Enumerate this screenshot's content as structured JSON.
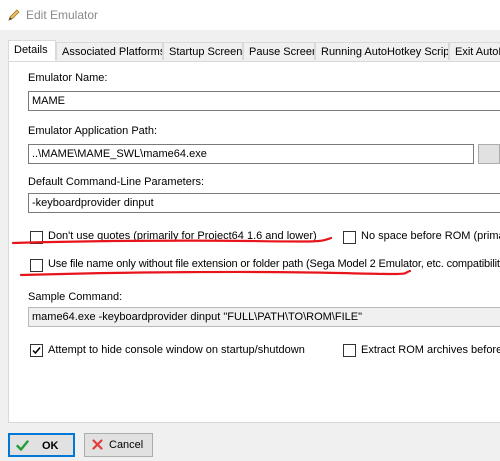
{
  "window": {
    "title": "Edit Emulator",
    "title_icon": "pencil-icon"
  },
  "tabs": [
    {
      "label": "Details",
      "active": true
    },
    {
      "label": "Associated Platforms",
      "active": false
    },
    {
      "label": "Startup Screen",
      "active": false
    },
    {
      "label": "Pause Screen",
      "active": false
    },
    {
      "label": "Running AutoHotkey Script",
      "active": false
    },
    {
      "label": "Exit AutoHo",
      "active": false
    }
  ],
  "form": {
    "name_label": "Emulator Name:",
    "name_value": "MAME",
    "path_label": "Emulator Application Path:",
    "path_value": "..\\MAME\\MAME_SWL\\mame64.exe",
    "params_label": "Default Command-Line Parameters:",
    "params_value": "-keyboardprovider dinput",
    "no_quotes_label": "Don't use quotes (primarily for Project64 1.6 and lower)",
    "no_quotes_checked": false,
    "no_space_label": "No space before ROM (primarily",
    "no_space_checked": false,
    "filename_only_label": "Use file name only without file extension or folder path (Sega Model 2 Emulator, etc. compatibility)",
    "filename_only_checked": false,
    "sample_label": "Sample Command:",
    "sample_value": "mame64.exe -keyboardprovider dinput \"FULL\\PATH\\TO\\ROM\\FILE\"",
    "hide_console_label": "Attempt to hide console window on startup/shutdown",
    "hide_console_checked": true,
    "extract_rom_label": "Extract ROM archives before ru",
    "extract_rom_checked": false
  },
  "buttons": {
    "ok_label": "OK",
    "ok_icon": "checkmark-icon",
    "cancel_label": "Cancel",
    "cancel_icon": "x-icon"
  },
  "colors": {
    "annotation_red": "#e8141c",
    "ok_check_green": "#1f9e3a",
    "cancel_x_red": "#e03c3c",
    "default_button_border": "#0078d7"
  }
}
